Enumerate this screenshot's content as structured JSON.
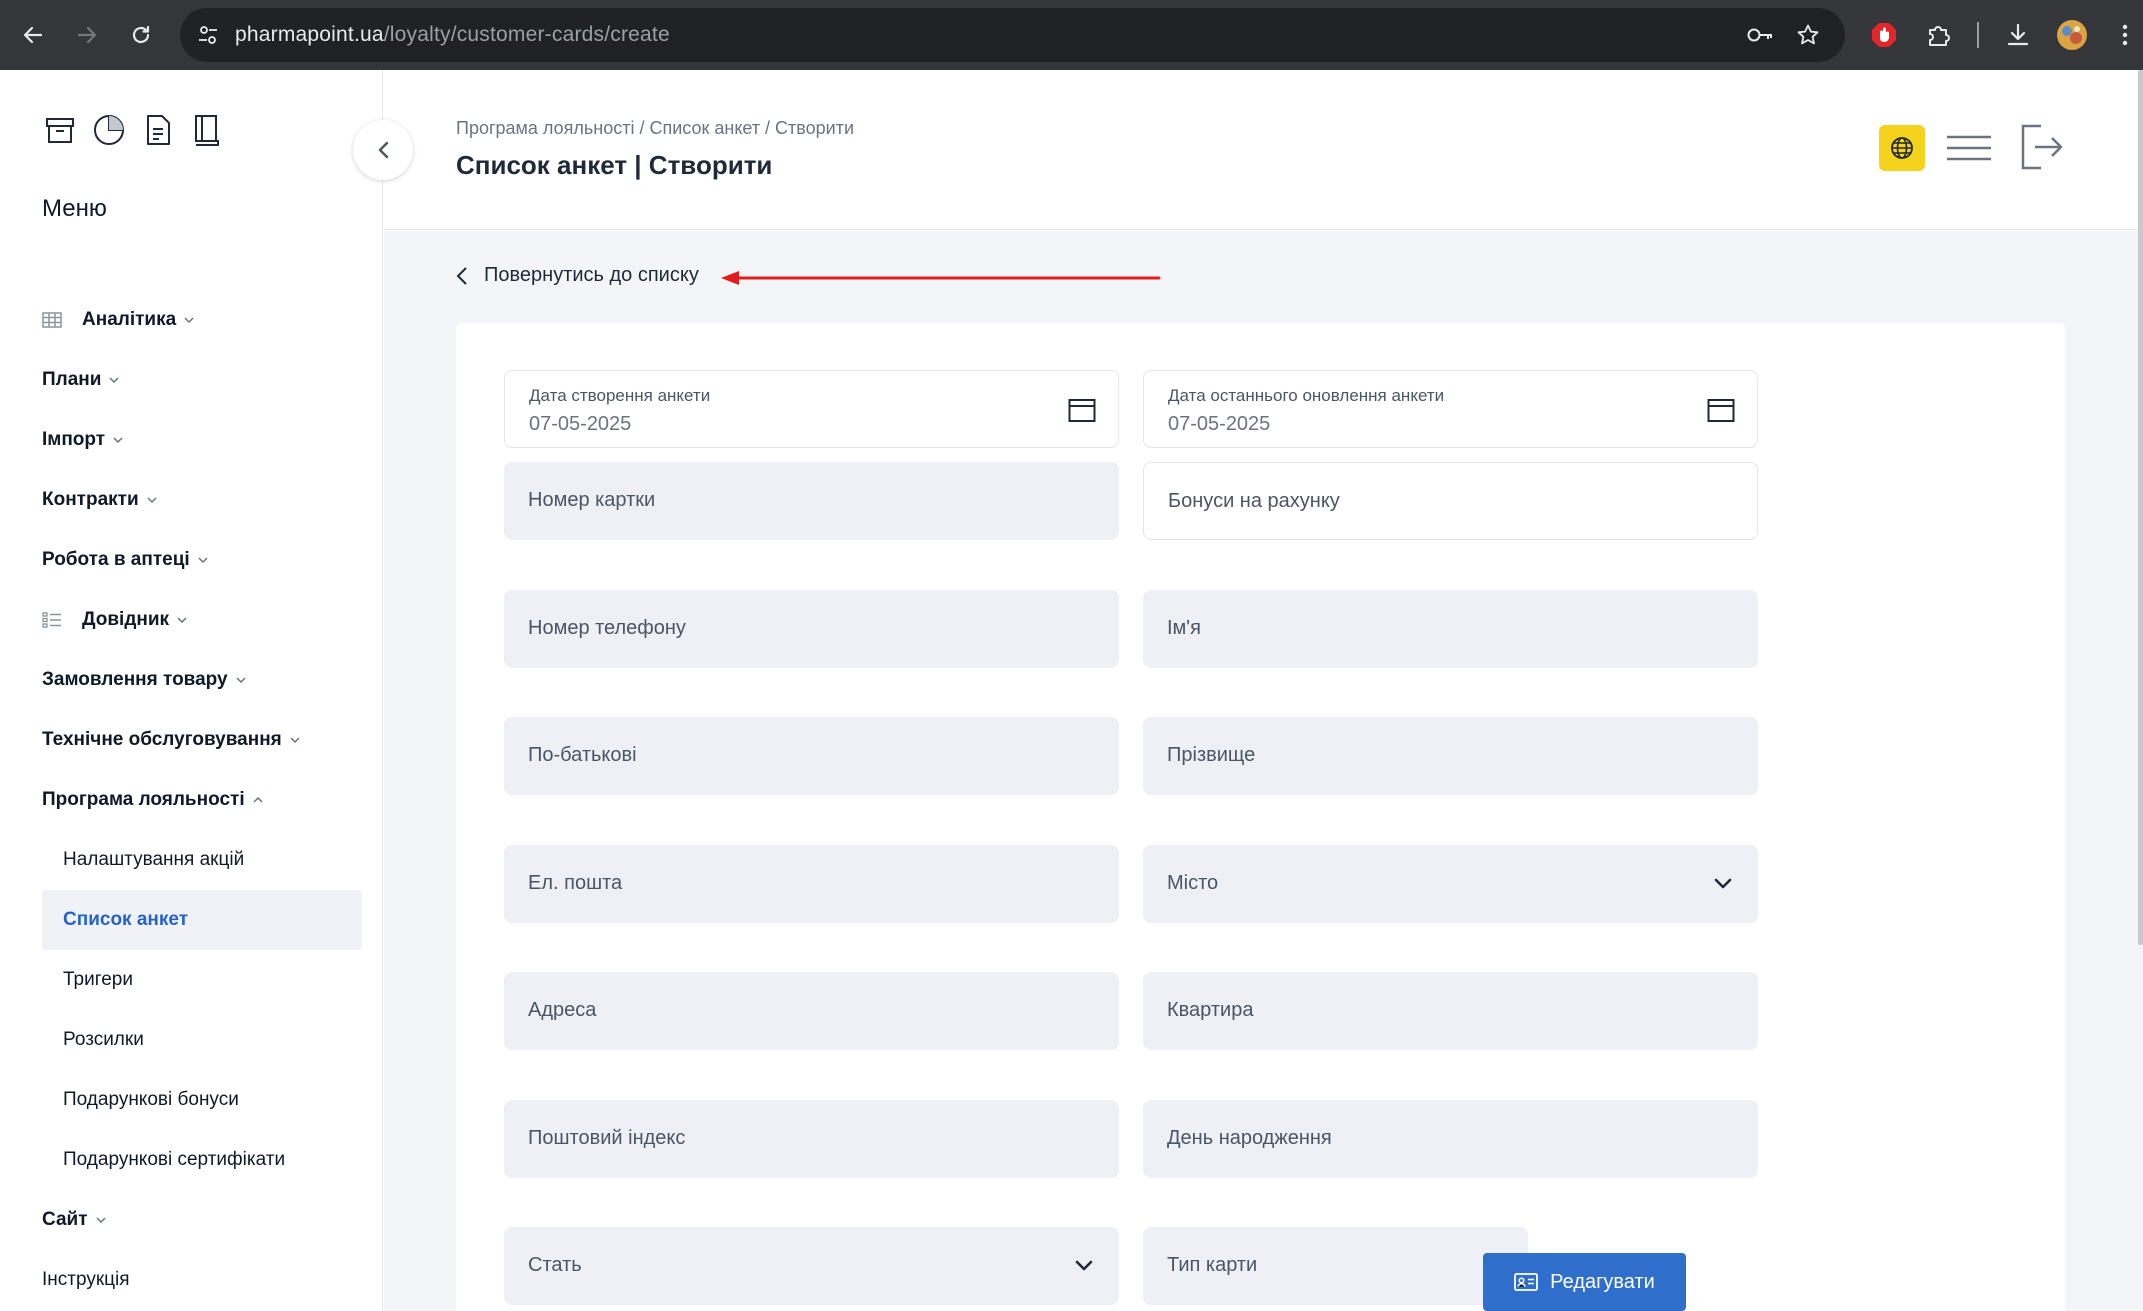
{
  "browser": {
    "url_domain": "pharmapoint.ua",
    "url_path": "/loyalty/customer-cards/create"
  },
  "sidebar": {
    "menu_title": "Меню",
    "top_icons": [
      "archive-icon",
      "pie-chart-icon",
      "document-icon",
      "book-icon"
    ],
    "items": [
      {
        "label": "Аналітика",
        "icon": "table-icon",
        "expanded": false
      },
      {
        "label": "Плани",
        "expanded": false
      },
      {
        "label": "Імпорт",
        "expanded": false
      },
      {
        "label": "Контракти",
        "expanded": false
      },
      {
        "label": "Робота в аптеці",
        "expanded": false
      },
      {
        "label": "Довідник",
        "icon": "list-icon",
        "expanded": false
      },
      {
        "label": "Замовлення товару",
        "expanded": false
      },
      {
        "label": "Технічне обслуговування",
        "expanded": false
      },
      {
        "label": "Програма лояльності",
        "expanded": true
      }
    ],
    "sub_items": [
      {
        "label": "Налаштування акцій",
        "active": false
      },
      {
        "label": "Список анкет",
        "active": true
      },
      {
        "label": "Тригери",
        "active": false
      },
      {
        "label": "Розсилки",
        "active": false
      },
      {
        "label": "Подарункові бонуси",
        "active": false
      },
      {
        "label": "Подарункові сертифікати",
        "active": false
      }
    ],
    "items_after": [
      {
        "label": "Сайт",
        "expanded": false
      }
    ],
    "last_item": "Інструкція"
  },
  "header": {
    "breadcrumb": "Програма лояльності / Список анкет / Створити",
    "title": "Список анкет | Створити"
  },
  "back_link": "Повернутись до списку",
  "form": {
    "created_date": {
      "label": "Дата створення анкети",
      "value": "07-05-2025"
    },
    "updated_date": {
      "label": "Дата останнього оновлення анкети",
      "value": "07-05-2025"
    },
    "card_number": "Номер картки",
    "bonuses": "Бонуси на рахунку",
    "phone": "Номер телефону",
    "first_name": "Ім'я",
    "patronymic": "По-батькові",
    "last_name": "Прізвище",
    "email": "Ел. пошта",
    "city": "Місто",
    "address": "Адреса",
    "apartment": "Квартира",
    "postal_code": "Поштовий індекс",
    "birthday": "День народження",
    "gender": "Стать",
    "card_type": "Тип карти",
    "edit_button": "Редагувати"
  },
  "colors": {
    "accent": "#2f6fcb",
    "active_nav_text": "#2563c9",
    "lang_button": "#f5d21c",
    "annotation_arrow": "#e11d1d"
  }
}
